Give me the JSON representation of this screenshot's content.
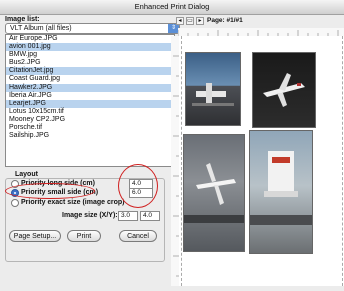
{
  "window": {
    "title": "Enhanced Print Dialog"
  },
  "image_list": {
    "label": "Image list:",
    "album_select": "VLT Album (all files)",
    "items": [
      {
        "name": "Air Europe.JPG",
        "selected": false
      },
      {
        "name": "avion 001.jpg",
        "selected": true
      },
      {
        "name": "BMW.jpg",
        "selected": false
      },
      {
        "name": "Bus2.JPG",
        "selected": false
      },
      {
        "name": "CitationJet.jpg",
        "selected": true
      },
      {
        "name": "Coast Guard.jpg",
        "selected": false
      },
      {
        "name": "Hawker2.JPG",
        "selected": true
      },
      {
        "name": "Iberia Air.JPG",
        "selected": false
      },
      {
        "name": "Learjet.JPG",
        "selected": true
      },
      {
        "name": "Lotus 10x15cm.tif",
        "selected": false
      },
      {
        "name": "Mooney CP2.JPG",
        "selected": false
      },
      {
        "name": "Porsche.tif",
        "selected": false
      },
      {
        "name": "Sailship.JPG",
        "selected": false
      }
    ]
  },
  "preview": {
    "page_label": "Page: #1/#1"
  },
  "layout": {
    "title": "Layout",
    "options": [
      {
        "label": "Priority   long side (cm)",
        "value": "4.0",
        "selected": false
      },
      {
        "label": "Priority   small side (cm)",
        "value": "6.0",
        "selected": true
      },
      {
        "label": "Priority   exact size (image crop)",
        "value": "",
        "selected": false
      }
    ],
    "image_size_label": "Image size (X/Y):",
    "image_size_x": "3.0",
    "image_size_y": "4.0"
  },
  "buttons": {
    "page_setup": "Page Setup...",
    "print": "Print",
    "cancel": "Cancel"
  },
  "colors": {
    "selection": "#b9d3ee",
    "highlight_circle": "#d02020",
    "accent": "#3d72c8"
  }
}
